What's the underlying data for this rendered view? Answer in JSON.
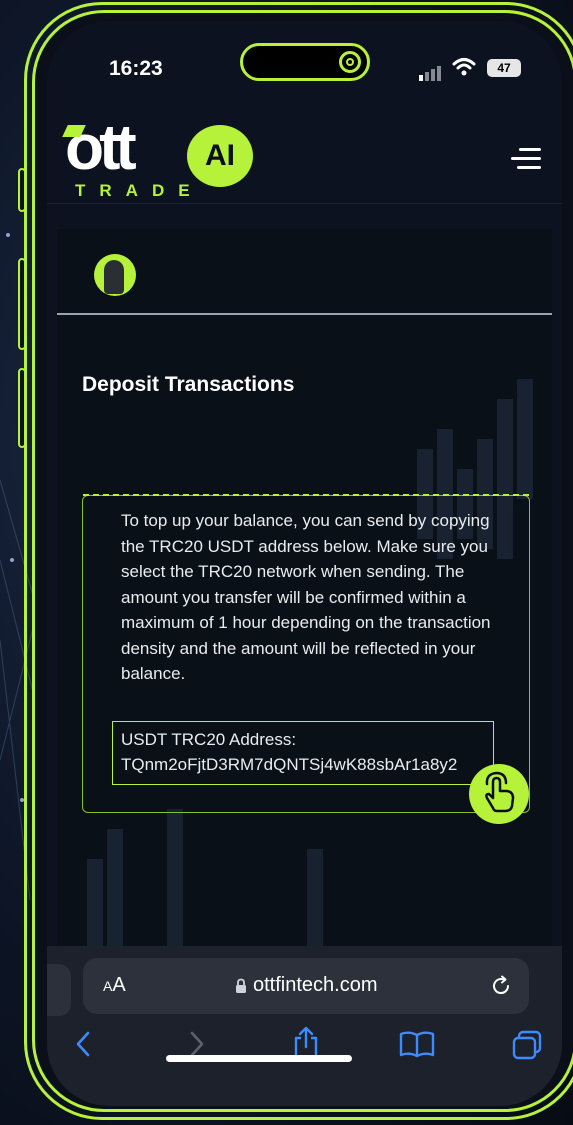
{
  "status_bar": {
    "time": "16:23",
    "battery": "47"
  },
  "site": {
    "logo_main": "ott",
    "logo_badge": "AI",
    "logo_sub": "TRADE"
  },
  "page": {
    "title": "Deposit Transactions",
    "info_text": "To top up your balance, you can send by copying the TRC20 USDT address below. Make sure you select the TRC20 network when sending. The amount you transfer will be confirmed within a maximum of 1 hour depending on the transaction density and the amount will be reflected in your balance.",
    "address_label": "USDT TRC20 Address:",
    "address_value": "TQnm2oFjtD3RM7dQNTSj4wK88sbAr1a8y2"
  },
  "browser": {
    "text_size_label_small": "A",
    "text_size_label_large": "A",
    "url": "ottfintech.com"
  },
  "colors": {
    "accent": "#b6f23a",
    "background": "#0c1220",
    "browser_chrome": "#1c212b",
    "nav_icon": "#3d8bfd"
  },
  "icons": [
    "signal-icon",
    "wifi-icon",
    "battery-icon",
    "menu-icon",
    "hand-pointer-icon",
    "lock-icon",
    "reload-icon",
    "back-icon",
    "forward-icon",
    "share-icon",
    "bookmarks-icon",
    "tabs-icon"
  ]
}
